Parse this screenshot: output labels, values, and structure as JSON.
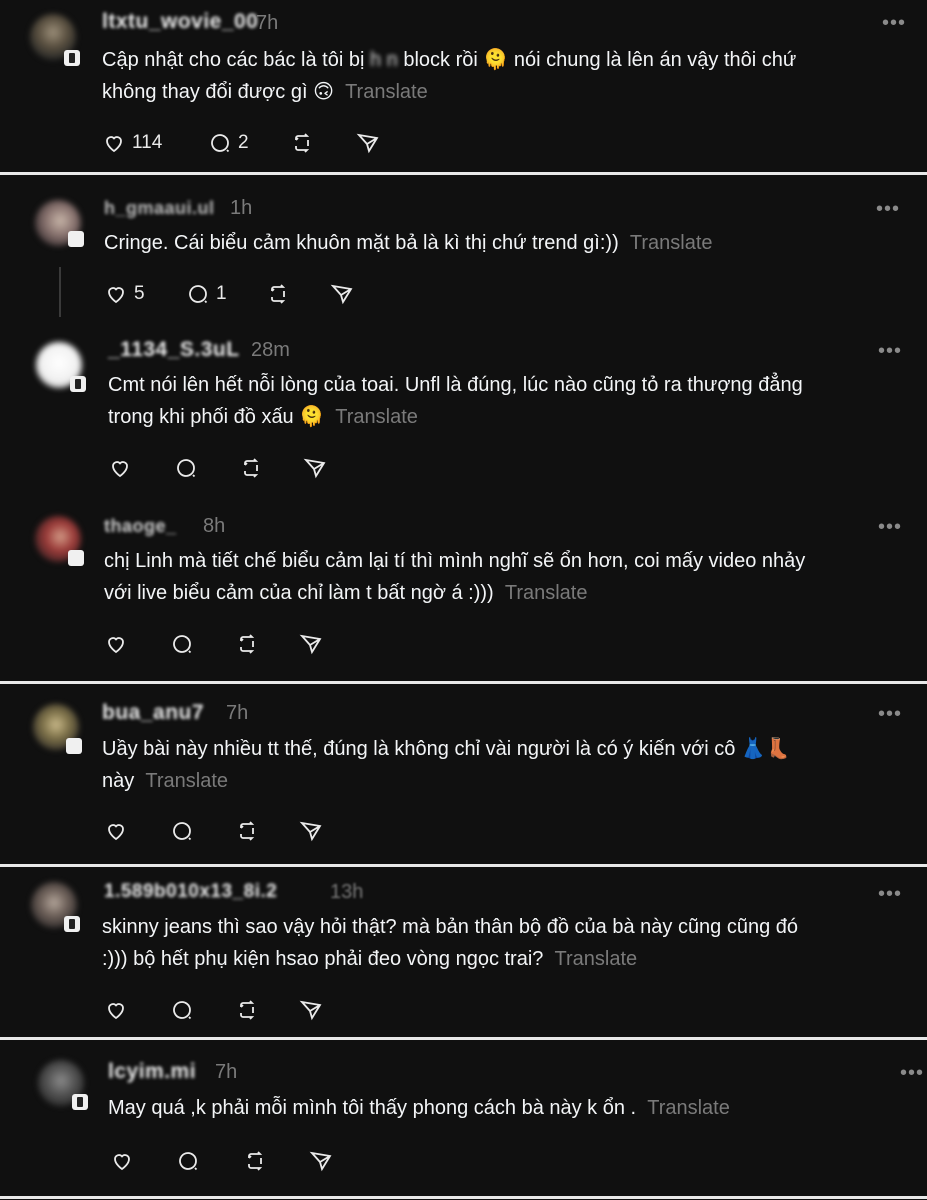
{
  "translate_label": "Translate",
  "posts": [
    {
      "username": "ltxtu_wovie_00",
      "time": "7h",
      "text_a": "Cập nhật cho các bác là tôi bị ",
      "redacted": "h n",
      "text_b": " block rồi ",
      "emoji1": "🫠",
      "text_c": " nói chung là lên án vậy thôi chứ",
      "text_d": "không thay đổi được gì ",
      "emoji2": "🙃",
      "likes": "114",
      "replies": "2"
    },
    {
      "username": "h_gmaaui.ul",
      "time": "1h",
      "text": "Cringe. Cái biểu cảm khuôn mặt bả là kì thị chứ trend gì:))",
      "likes": "5",
      "replies": "1"
    },
    {
      "username": "_1134_S.3uL",
      "time": "28m",
      "text_line1": "Cmt nói lên hết nỗi lòng của toai. Unfl là đúng, lúc nào cũng tỏ ra thượng đẳng",
      "text_line2": "trong khi phối đồ xấu ",
      "emoji": "🫠"
    },
    {
      "username": "thaoge_",
      "time": "8h",
      "text_line1": "chị Linh mà tiết chế biểu cảm lại tí thì mình nghĩ sẽ ổn hơn, coi mấy video nhảy",
      "text_line2": "với live biểu cảm của chỉ làm t bất ngờ á :)))"
    },
    {
      "username": "bua_anu7",
      "time": "7h",
      "text_line1": "Uầy bài này nhiều tt thế, đúng là không chỉ vài người là có ý kiến với cô ",
      "emoji_dress": "👗",
      "emoji_boot": "👢",
      "text_line2": "này"
    },
    {
      "username": "1.589b010x13_8i.2",
      "time": "13h",
      "text_line1": "skinny jeans thì sao vậy hỏi thật? mà bản thân bộ đồ của bà này cũng cũng đó",
      "text_line2": ":))) bộ hết phụ kiện hsao phải đeo vòng ngọc trai?"
    },
    {
      "username": "lcyim.mi",
      "time": "7h",
      "text": "May quá ,k phải mỗi mình tôi thấy phong cách bà này k ổn ."
    }
  ],
  "icons": {
    "like": "heart-icon",
    "reply": "comment-icon",
    "repost": "repost-icon",
    "share": "send-icon",
    "more": "more-icon"
  }
}
